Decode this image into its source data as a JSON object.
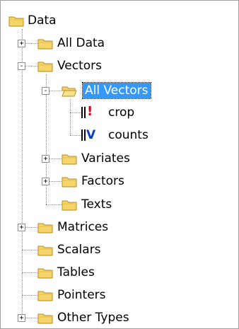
{
  "tree": {
    "root": {
      "label": "Data",
      "icon": "folder-icon"
    },
    "all_data": {
      "label": "All Data",
      "expander": "+",
      "icon": "folder-icon"
    },
    "vectors": {
      "label": "Vectors",
      "expander": "-",
      "icon": "folder-icon"
    },
    "all_vectors": {
      "label": "All Vectors",
      "expander": "-",
      "icon": "open-folder-icon",
      "selected": true
    },
    "crop": {
      "label": "crop",
      "icon": "factor-vector-icon",
      "icon_text": "!"
    },
    "counts": {
      "label": "counts",
      "icon": "variate-vector-icon",
      "icon_text": "V"
    },
    "variates": {
      "label": "Variates",
      "expander": "+",
      "icon": "folder-icon"
    },
    "factors": {
      "label": "Factors",
      "expander": "+",
      "icon": "folder-icon"
    },
    "texts": {
      "label": "Texts",
      "icon": "folder-icon"
    },
    "matrices": {
      "label": "Matrices",
      "expander": "+",
      "icon": "folder-icon"
    },
    "scalars": {
      "label": "Scalars",
      "icon": "folder-icon"
    },
    "tables": {
      "label": "Tables",
      "icon": "folder-icon"
    },
    "pointers": {
      "label": "Pointers",
      "icon": "folder-icon"
    },
    "other_types": {
      "label": "Other Types",
      "expander": "+",
      "icon": "folder-icon"
    }
  },
  "colors": {
    "selection": "#3399ff",
    "folder_fill": "#f5d56a",
    "folder_edge": "#b88a1e",
    "factor_icon": "#d0021b",
    "variate_icon": "#0b3ec7"
  }
}
